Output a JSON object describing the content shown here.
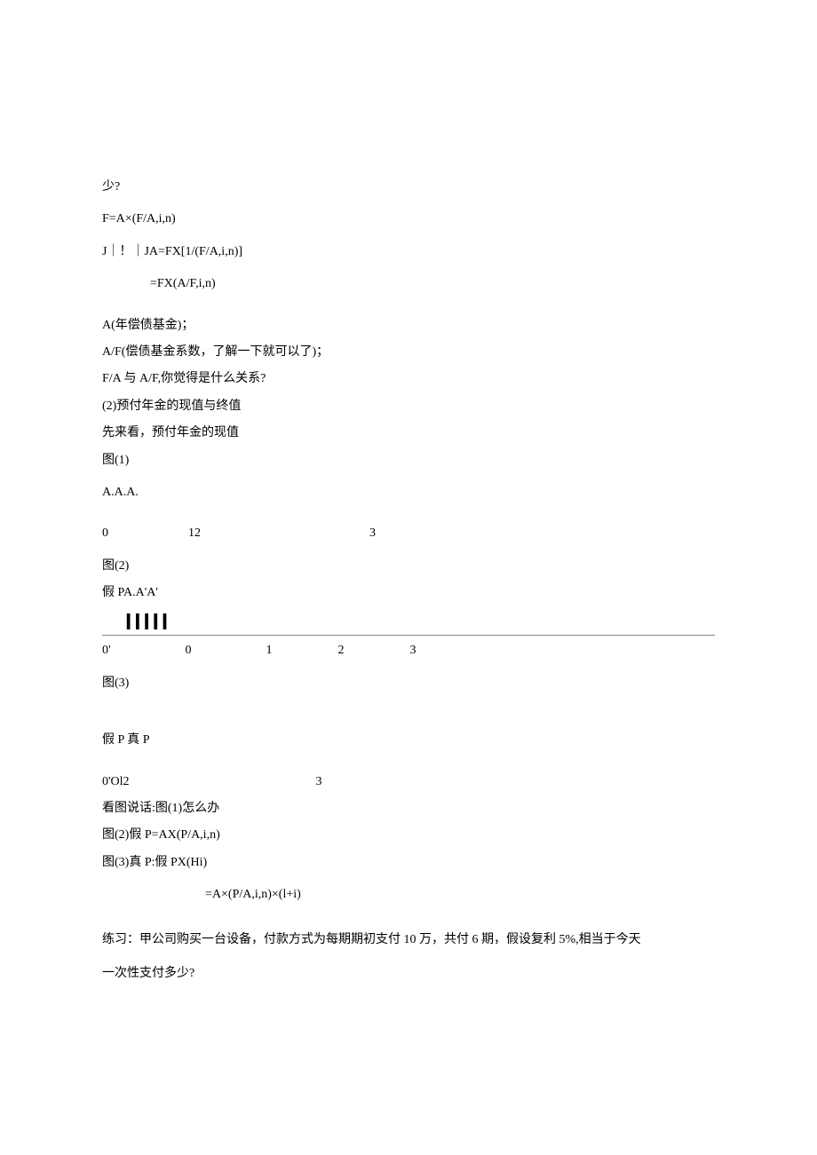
{
  "lines": {
    "l1": "少?",
    "l2": "F=A×(F/A,i,n)",
    "l3": "J｜！｜JA=FX[1/(F/A,i,n)]",
    "l4": "=FX(A/F,i,n)",
    "l5": "A(年偿债基金)；",
    "l6": "A/F(偿债基金系数，了解一下就可以了)；",
    "l7": "F/A 与 A/F,你觉得是什么关系?",
    "l8": "(2)预付年金的现值与终值",
    "l9": "先来看，预付年金的现值",
    "l10": "图(1)",
    "l11": "A.A.A.",
    "row1_a": "0",
    "row1_b": "12",
    "row1_c": "3",
    "l12": "图(2)",
    "l13": "假 PA.A'A'",
    "bars": "IIIII",
    "row2_a": "0'",
    "row2_b": "0",
    "row2_c": "1",
    "row2_d": "2",
    "row2_e": "3",
    "l14": "图(3)",
    "l15": "假 P 真 P",
    "row3_a": "0'Ol2",
    "row3_b": "3",
    "l16": "看图说话:图(1)怎么办",
    "l17": "图(2)假 P=AX(P/A,i,n)",
    "l18": "图(3)真 P:假 PX(Hi)",
    "l19": "=A×(P/A,i,n)×(l+i)",
    "l20": "练习：甲公司购买一台设备，付款方式为每期期初支付 10 万，共付 6 期，假设复利 5%,相当于今天",
    "l21": "一次性支付多少?"
  }
}
